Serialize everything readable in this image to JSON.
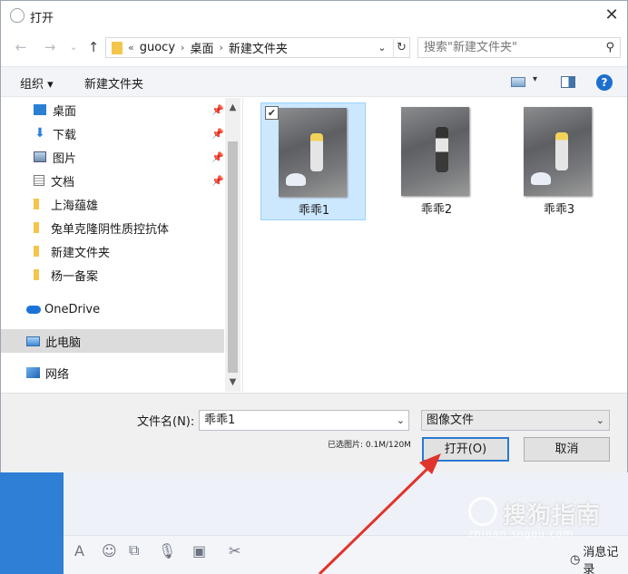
{
  "dialog": {
    "title": "打开",
    "close": "✕"
  },
  "nav": {
    "back": "←",
    "forward": "→",
    "history": "⌄",
    "up": "↑",
    "breadcrumb_prefix": "«",
    "breadcrumb": [
      "guocy",
      "桌面",
      "新建文件夹"
    ],
    "breadcrumb_sep": "›",
    "addr_drop": "⌄",
    "refresh": "↻",
    "search_placeholder": "搜索\"新建文件夹\""
  },
  "command_bar": {
    "organize": "组织 ▾",
    "new_folder": "新建文件夹",
    "view_drop": "▾",
    "help": "?"
  },
  "navpane": {
    "items": [
      {
        "label": "桌面",
        "icon": "desktop-icon",
        "pinned": true
      },
      {
        "label": "下载",
        "icon": "download-icon",
        "pinned": true
      },
      {
        "label": "图片",
        "icon": "pictures-icon",
        "pinned": true
      },
      {
        "label": "文档",
        "icon": "documents-icon",
        "pinned": true
      },
      {
        "label": "上海蕴雄",
        "icon": "folder-icon",
        "pinned": false
      },
      {
        "label": "兔单克隆阴性质控抗体",
        "icon": "folder-icon",
        "pinned": false
      },
      {
        "label": "新建文件夹",
        "icon": "folder-icon",
        "pinned": false
      },
      {
        "label": "杨一备案",
        "icon": "folder-icon",
        "pinned": false
      },
      {
        "label": "OneDrive",
        "icon": "cloud-icon",
        "pinned": false
      },
      {
        "label": "此电脑",
        "icon": "computer-icon",
        "pinned": false,
        "selected": true
      },
      {
        "label": "网络",
        "icon": "network-icon",
        "pinned": false
      }
    ],
    "pin_glyph": "📌",
    "scroll_up": "▲",
    "scroll_down": "▼"
  },
  "files": [
    {
      "name": "乖乖1",
      "selected": true
    },
    {
      "name": "乖乖2",
      "selected": false
    },
    {
      "name": "乖乖3",
      "selected": false
    }
  ],
  "footer": {
    "filename_label": "文件名(N):",
    "filename_value": "乖乖1",
    "filetype_value": "图像文件",
    "selection_info": "已选图片: 0.1M/120M",
    "open_button": "打开(O)",
    "cancel_button": "取消"
  },
  "background_app": {
    "message_record": "消息记录"
  },
  "watermark": {
    "text": "搜狗指南",
    "sub": "zhinan.sogou.com"
  },
  "colors": {
    "accent": "#2b78d1",
    "selection_bg": "#cce8ff",
    "annotation_arrow": "#e0342c",
    "app_blue": "#2f7fd6"
  }
}
